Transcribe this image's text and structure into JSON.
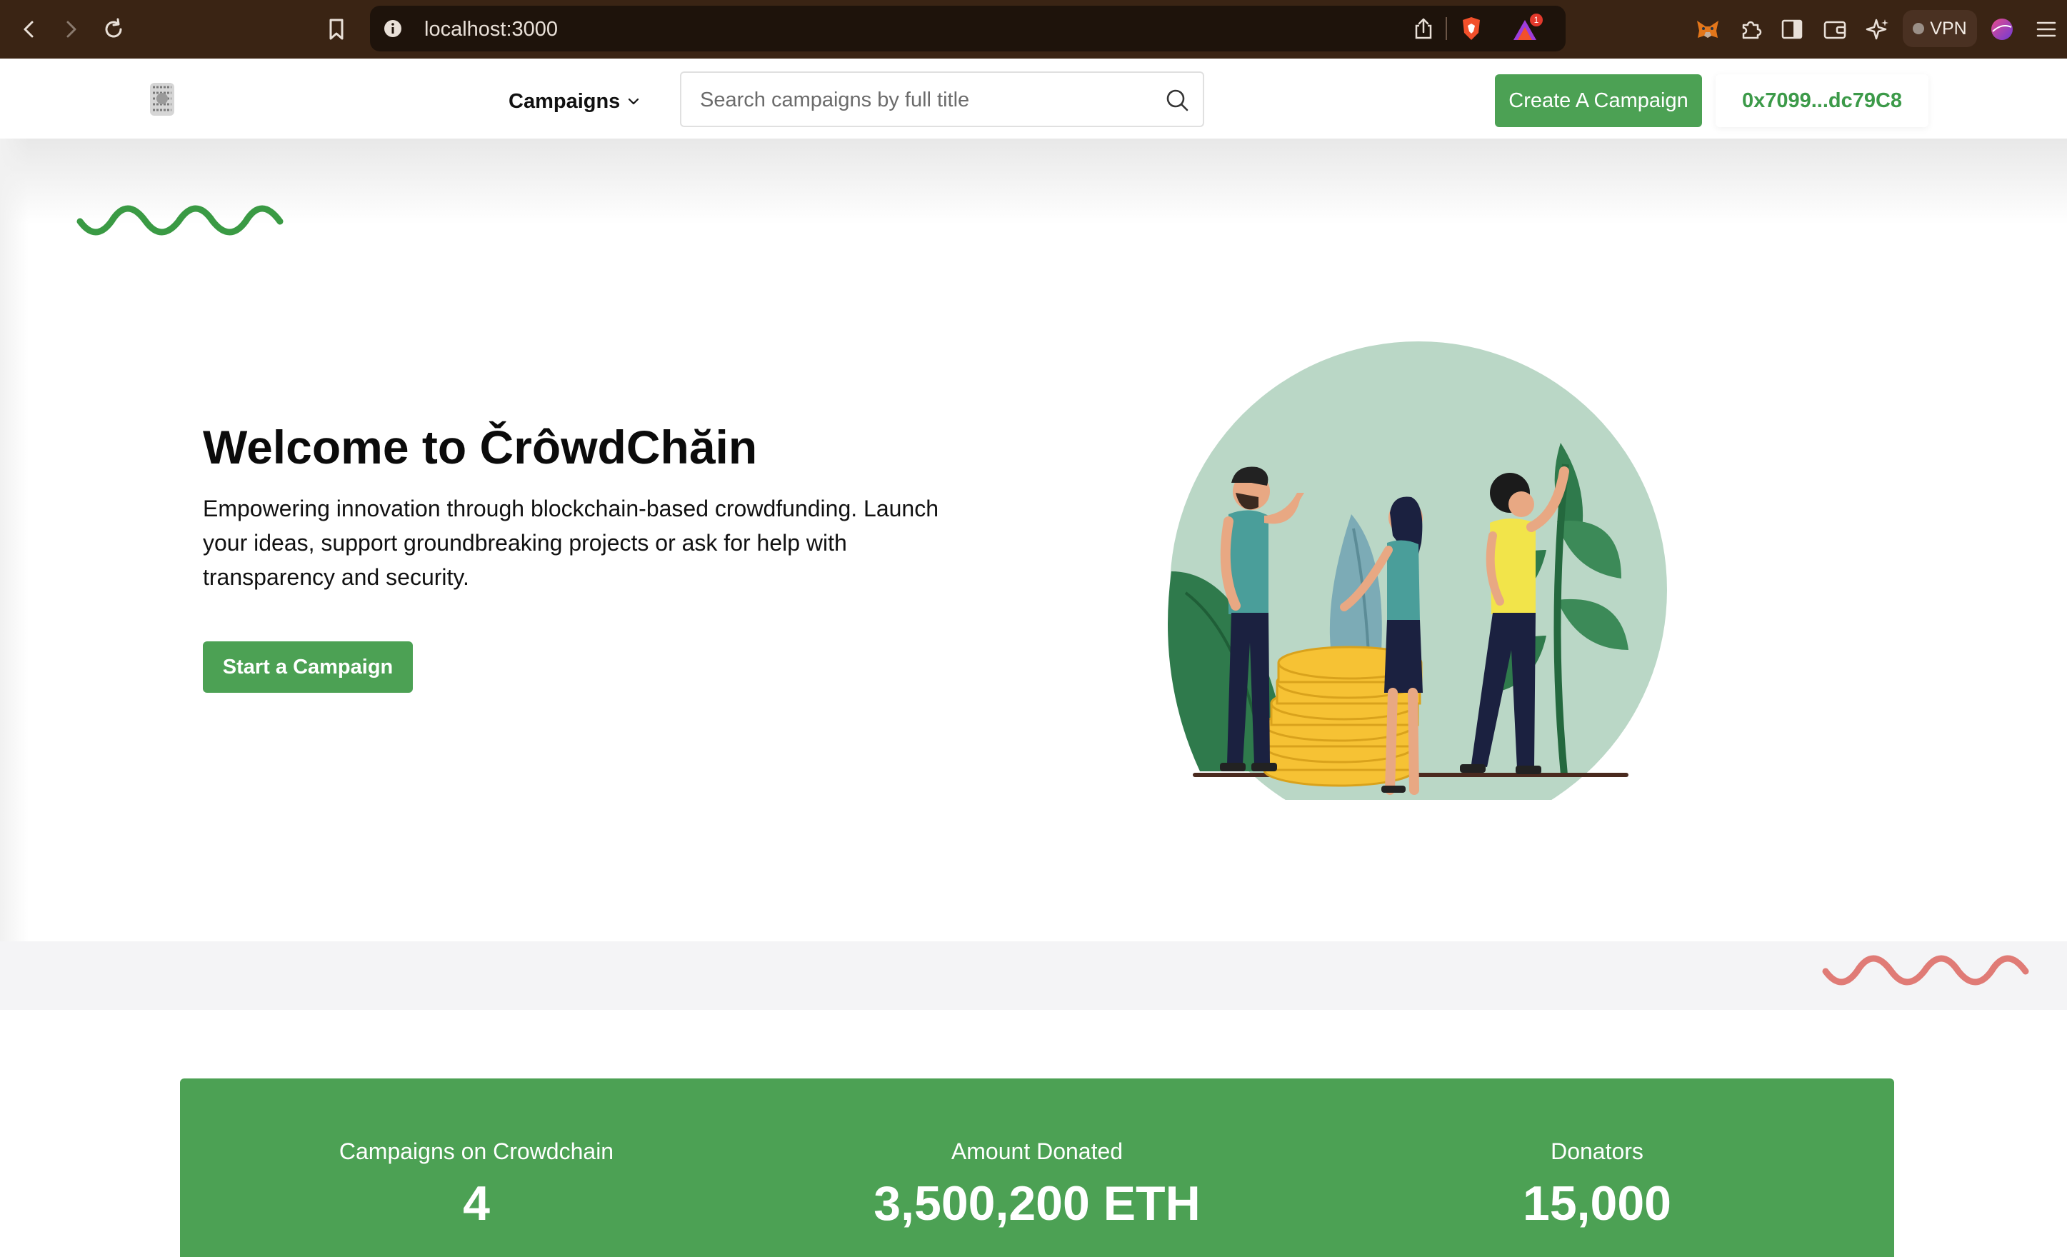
{
  "browser": {
    "url": "localhost:3000",
    "vpn_label": "VPN",
    "notification_count": "1"
  },
  "header": {
    "campaigns_menu_label": "Campaigns",
    "search_placeholder": "Search campaigns by full title",
    "create_button_label": "Create A Campaign",
    "wallet_address": "0x7099...dc79C8"
  },
  "hero": {
    "title": "Welcome to ČrôwdChăin",
    "description": "Empowering innovation through blockchain-based crowdfunding. Launch your ideas, support groundbreaking projects or ask for help with transparency and security.",
    "cta_label": "Start a Campaign"
  },
  "stats": [
    {
      "label": "Campaigns on Crowdchain",
      "value": "4"
    },
    {
      "label": "Amount Donated",
      "value": "3,500,200 ETH"
    },
    {
      "label": "Donators",
      "value": "15,000"
    }
  ],
  "colors": {
    "brand_green": "#4ca154",
    "accent_red": "#e07b76",
    "browser_chrome": "#3a2414"
  },
  "icons": {
    "browser": [
      "back-icon",
      "forward-icon",
      "reload-icon",
      "bookmark-icon",
      "info-icon",
      "share-icon",
      "brave-shield-icon",
      "brave-rewards-icon",
      "metamask-icon",
      "extensions-icon",
      "sidebar-icon",
      "wallet-icon",
      "leo-ai-icon",
      "profile-icon",
      "menu-icon"
    ],
    "app": [
      "logo-icon",
      "chevron-down-icon",
      "search-icon"
    ]
  }
}
